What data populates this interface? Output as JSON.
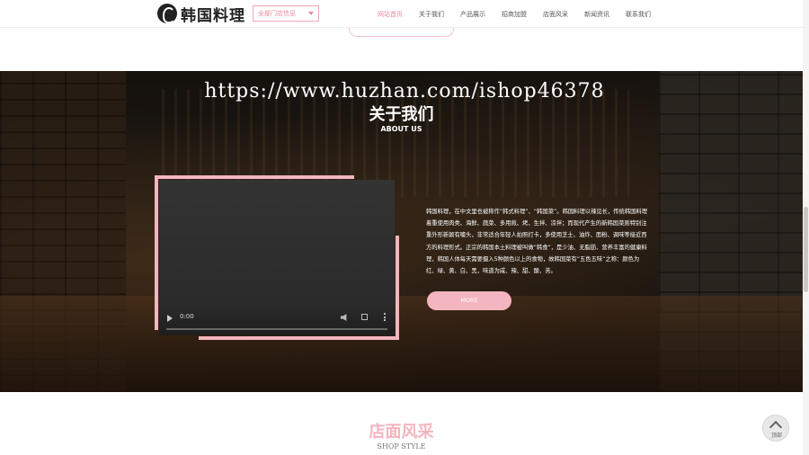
{
  "header": {
    "logo_text": "韩国料理",
    "store_select": "全部门店信息",
    "nav": [
      "网站首页",
      "关于我们",
      "产品展示",
      "招商加盟",
      "店面风采",
      "新闻资讯",
      "联系我们"
    ],
    "active_nav": "网站首页"
  },
  "about": {
    "watermark": "https://www.huzhan.com/ishop46378",
    "title": "关于我们",
    "subtitle": "ABOUT US",
    "video_time": "0:00",
    "text": "韩国料理，在中文里也被称作“韩式料理”、“韩国菜”。韩国料理以辣见长，传统韩国料理着重使用肉类、海鲜、蔬菜、多用煎、烤、生拌、凉拌；而现代产生的新韩国菜则特别注重外形新颖有噱头，非常适合年轻人拍照打卡，多使用芝士、油炸、面粉、调味等接近西方的料理形式。正宗的韩国本土料理被叫做“韩食”，是少油、无脂肪、营养丰富的健康料理，韩国人体每天需要摄入5种颜色以上的食物，故韩国菜有“五色五味”之称：颜色为红、绿、黄、白、黑，味道为咸、辣、甜、酸、苦。",
    "more_label": "MORE"
  },
  "shop": {
    "title": "店面风采",
    "subtitle": "SHOP STYLE"
  },
  "to_top_label": "顶部",
  "colors": {
    "accent_pink": "#f3b5bf",
    "nav_active": "#e98a9d"
  }
}
